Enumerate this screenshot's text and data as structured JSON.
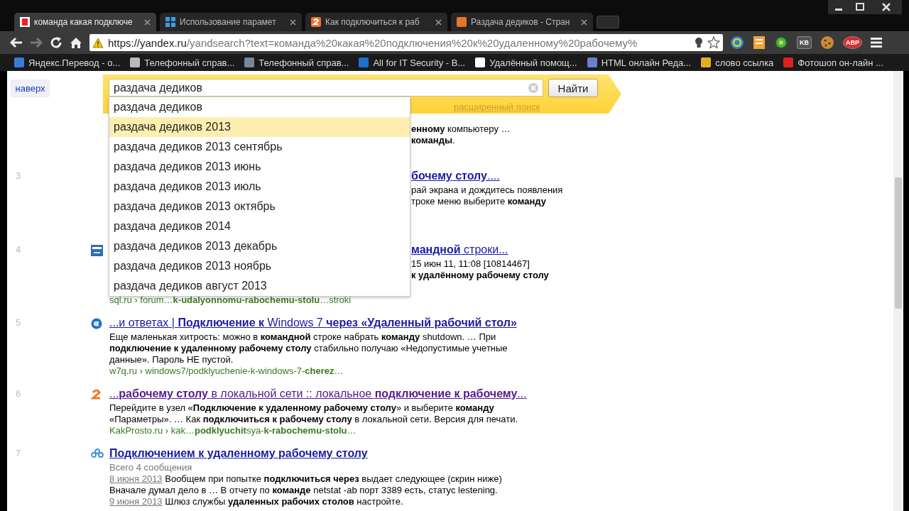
{
  "browser": {
    "tabs": [
      {
        "label": "команда какая подключе",
        "selected": true
      },
      {
        "label": "Использование парамет",
        "selected": false
      },
      {
        "label": "Как подключиться к раб",
        "selected": false
      },
      {
        "label": "Раздача дедиков - Стран",
        "selected": false
      }
    ],
    "address": {
      "host": "https://yandex.ru",
      "rest": "/yandsearch?text=команда%20какая%20подключения%20к%20удаленному%20рабочему%"
    },
    "extension_labels": [
      "KB",
      "ABP"
    ],
    "bookmarks": [
      "Яндекс.Перевод - о...",
      "Телефонный справ...",
      "Телефонный справ...",
      "All for IT Security - B...",
      "Удалённый помощ...",
      "HTML онлайн Реда...",
      "слово ссылка",
      "Фотошоп он-лайн ..."
    ]
  },
  "page": {
    "top_button": "наверх",
    "search": {
      "value": "раздача дедиков",
      "button": "Найти",
      "advanced_link": "расширенный поиск"
    },
    "suggestions": [
      {
        "text": "раздача дедиков",
        "selected": false
      },
      {
        "text": "раздача дедиков 2013",
        "selected": true
      },
      {
        "text": "раздача дедиков 2013 сентябрь",
        "selected": false
      },
      {
        "text": "раздача дедиков 2013 июнь",
        "selected": false
      },
      {
        "text": "раздача дедиков 2013 июль",
        "selected": false
      },
      {
        "text": "раздача дедиков 2013 октябрь",
        "selected": false
      },
      {
        "text": "раздача дедиков 2014",
        "selected": false
      },
      {
        "text": "раздача дедиков 2013 декабрь",
        "selected": false
      },
      {
        "text": "раздача дедиков 2013 ноябрь",
        "selected": false
      },
      {
        "text": "раздача дедиков август 2013",
        "selected": false
      }
    ],
    "results": [
      {
        "kind": "snippet",
        "lines": [
          {
            "text": "**енному** компьютеру …"
          },
          {
            "text": "**команды**."
          }
        ]
      },
      {
        "kind": "snippet",
        "number": "3",
        "visited": false,
        "title": "**бочему столу**....",
        "lines": [
          {
            "text": "рай экрана и дождитесь появления"
          },
          {
            "text": "троке меню выберите **команду**"
          }
        ]
      },
      {
        "kind": "snippet",
        "number": "4",
        "visited": false,
        "title": "**мандной** строки...",
        "lines": [
          {
            "text": "15 июн 11, 11:08 [10814467]"
          },
          {
            "text": "**к удалённому рабочему столу**"
          }
        ],
        "url": "sql.ru › forum…**k-udalyonnomu-rabochemu-stolu**…stroki"
      },
      {
        "kind": "snippet",
        "number": "5",
        "visited": false,
        "title": "...и ответах | **Подключение к** Windows 7 **через «Удаленный рабочий стол»**",
        "lines": [
          {
            "text": "Еще маленькая хитрость: можно в **командной** строке набрать **команду** shutdown. … При"
          },
          {
            "text": "**подключение к удаленному рабочему столу** стабильно получаю «Недопустимые учетные"
          },
          {
            "text": "данные». Пароль НЕ пустой."
          }
        ],
        "url": "w7q.ru › windows7/podklyuchenie-k-windows-7-**cherez**…"
      },
      {
        "kind": "snippet",
        "number": "6",
        "visited": true,
        "title": "...**рабочему столу** в локальной сети :: локальное **подключение к рабочему**...",
        "lines": [
          {
            "text": "Перейдите в узел «**Подключение к удаленному рабочему столу**» и выберите **команду**"
          },
          {
            "text": "«Параметры». … Как **подключиться к рабочему столу** в локальной сети. Версия для печати."
          }
        ],
        "url": "KakProsto.ru › kak…**podklyuchit**sya-**k-rabochemu-stolu**…"
      },
      {
        "kind": "forum",
        "number": "7",
        "visited": false,
        "title": "Подключением к удаленному рабочему столу",
        "meta": "Всего 4 сообщения",
        "lines": [
          {
            "date": "8 июня 2013",
            "text": "Вообщем при попытке **подключиться через** выдает следующее (скрин ниже)"
          },
          {
            "text": "Вначале думал дело в … В отчету по **команде** netstat -ab порт 3389 есть, статус lestening."
          },
          {
            "date": "9 июня 2013",
            "text": "Шлюз службы **удаленных рабочих столов** настройте."
          }
        ]
      }
    ]
  }
}
